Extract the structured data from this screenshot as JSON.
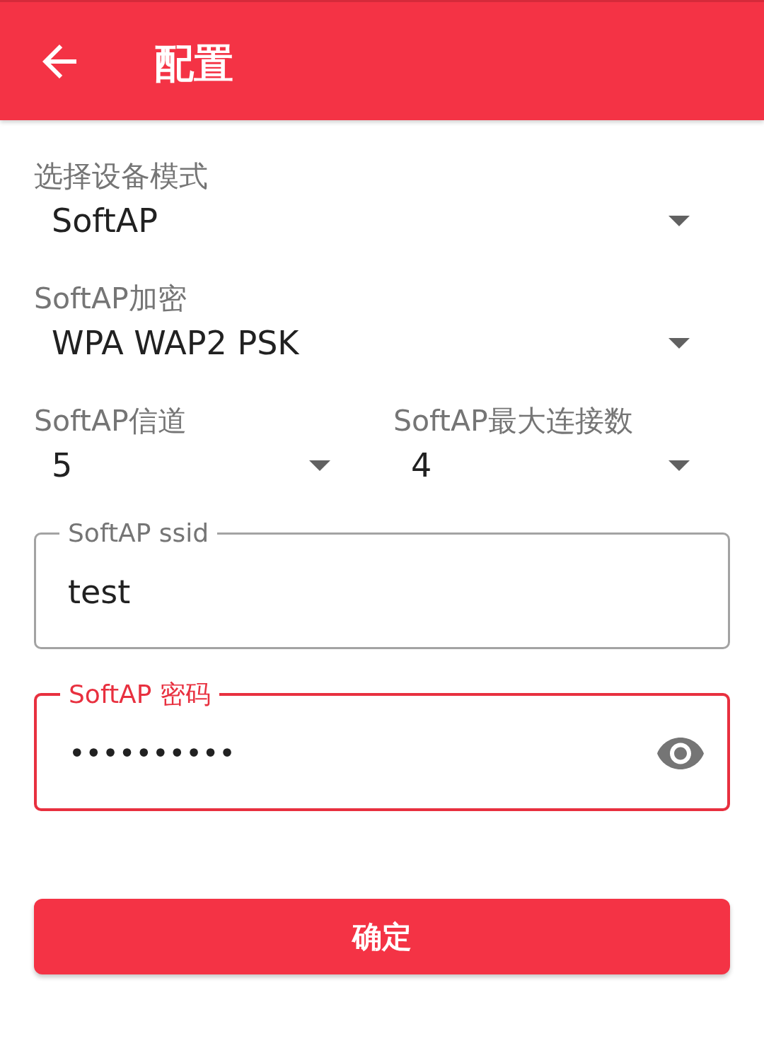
{
  "app_bar": {
    "title": "配置"
  },
  "selects": [
    {
      "items": [
        {
          "label": "选择设备模式",
          "value": "SoftAP"
        }
      ]
    },
    {
      "items": [
        {
          "label": "SoftAP加密",
          "value": "WPA WAP2 PSK"
        }
      ]
    },
    {
      "items": [
        {
          "label": "SoftAP信道",
          "value": "5"
        },
        {
          "label": "SoftAP最大连接数",
          "value": "4"
        }
      ]
    }
  ],
  "text_fields": [
    {
      "kind": "text",
      "label": "SoftAP ssid",
      "value": "test",
      "focused": false
    },
    {
      "kind": "password",
      "label": "SoftAP 密码",
      "value": "••••••••••",
      "focused": true
    }
  ],
  "confirm_button": {
    "label": "确定"
  }
}
